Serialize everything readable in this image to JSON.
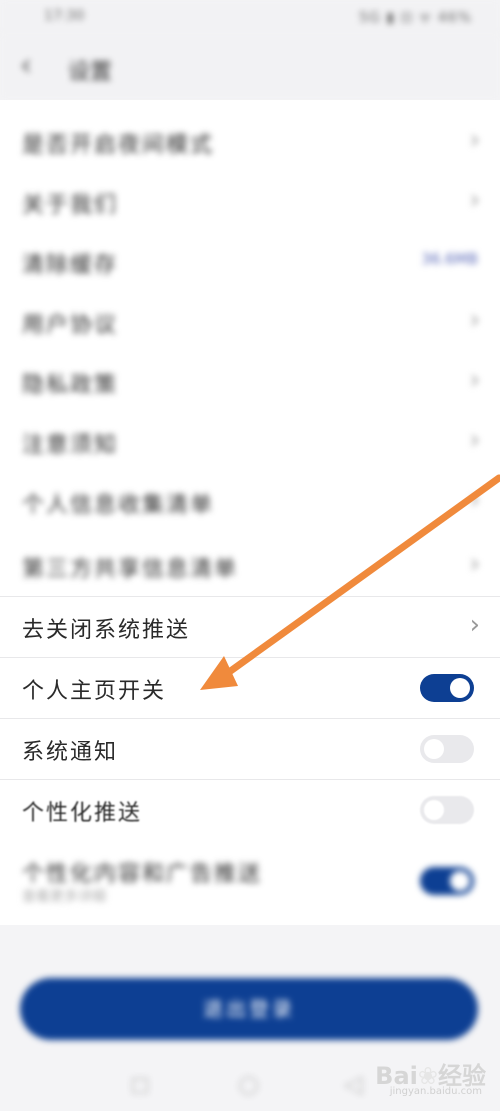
{
  "status_bar": {
    "time": "17:30",
    "icons": "5G ▮ ⊡ ᯤ 46%"
  },
  "header": {
    "back_icon": "chevron-left-icon",
    "title": "设置"
  },
  "rows": [
    {
      "label": "是否开启夜间模式",
      "type": "chevron"
    },
    {
      "label": "关于我们",
      "type": "chevron"
    },
    {
      "label": "清除缓存",
      "type": "value",
      "value": "36.6MB"
    },
    {
      "label": "用户协议",
      "type": "chevron"
    },
    {
      "label": "隐私政策",
      "type": "chevron"
    },
    {
      "label": "注意须知",
      "type": "chevron"
    },
    {
      "label": "个人信息收集清单",
      "type": "chevron"
    },
    {
      "label": "第三方共享信息清单",
      "type": "chevron"
    },
    {
      "label": "去关闭系统推送",
      "type": "chevron"
    },
    {
      "label": "个人主页开关",
      "type": "toggle",
      "on": true
    },
    {
      "label": "系统通知",
      "type": "toggle",
      "on": false
    },
    {
      "label": "个性化推送",
      "type": "toggle",
      "on": false
    },
    {
      "label": "个性化内容和广告推送",
      "sublabel": "查看更多详细",
      "type": "toggle",
      "on": true
    }
  ],
  "bottom_button": {
    "label": "退出登录"
  },
  "chevron_glyph": "›",
  "watermark": {
    "logo": "Bai du 经验",
    "url": "jingyan.baidu.com"
  },
  "colors": {
    "accent": "#0d3f93",
    "arrow": "#f08a3c"
  }
}
